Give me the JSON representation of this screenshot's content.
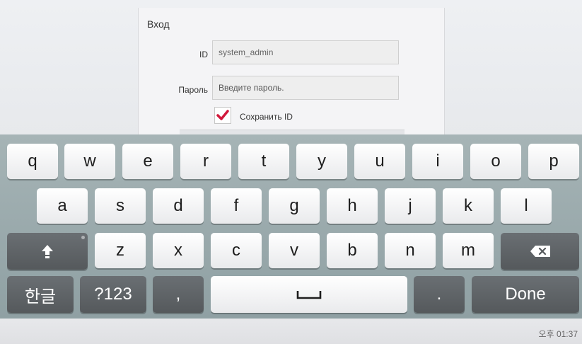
{
  "dialog": {
    "title": "Вход",
    "id_label": "ID",
    "id_value": "system_admin",
    "password_label": "Пароль",
    "password_placeholder": "Введите пароль.",
    "remember_label": "Сохранить ID",
    "remember_checked": true
  },
  "keyboard": {
    "row1": [
      "q",
      "w",
      "e",
      "r",
      "t",
      "y",
      "u",
      "i",
      "o",
      "p"
    ],
    "row2": [
      "a",
      "s",
      "d",
      "f",
      "g",
      "h",
      "j",
      "k",
      "l"
    ],
    "row3": [
      "z",
      "x",
      "c",
      "v",
      "b",
      "n",
      "m"
    ],
    "lang_key": "한글",
    "sym_key": "?123",
    "comma_key": ",",
    "period_key": ".",
    "done_key": "Done",
    "shift_icon": "shift-arrow-icon",
    "backspace_icon": "backspace-icon",
    "space_icon": "space-icon"
  },
  "status": {
    "time": "오후 01:37"
  }
}
